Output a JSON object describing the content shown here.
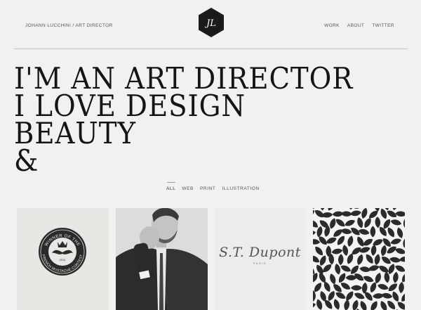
{
  "header": {
    "author_label": "JOHANN LUCCHINI / ART DIRECTOR",
    "logo_icon": "hexagon-monogram-logo-icon",
    "logo_text": "JL",
    "nav": [
      {
        "label": "WORK"
      },
      {
        "label": "ABOUT"
      },
      {
        "label": "TWITTER"
      }
    ]
  },
  "hero": {
    "lines": [
      "I'M AN ART DIRECTOR",
      "I LOVE DESIGN",
      "BEAUTY",
      "&"
    ]
  },
  "filters": [
    {
      "label": "ALL",
      "active": true
    },
    {
      "label": "WEB",
      "active": false
    },
    {
      "label": "PRINT",
      "active": false
    },
    {
      "label": "ILLUSTRATION",
      "active": false
    }
  ],
  "portfolio": [
    {
      "kind": "badge",
      "ring_top": "WINNER OF THE",
      "ring_bottom": "FRENCH MUSTACHE CONTEST",
      "year": "2012"
    },
    {
      "kind": "photo",
      "subject": "portrait-photo"
    },
    {
      "kind": "logo",
      "wordmark": "S.T. Dupont",
      "subtext": "PARIS"
    },
    {
      "kind": "pattern",
      "subject": "leaf-pattern"
    }
  ],
  "colors": {
    "background": "#f1f1f1",
    "text": "#151515",
    "muted": "#555555",
    "logo_fill": "#1a1a1a"
  }
}
